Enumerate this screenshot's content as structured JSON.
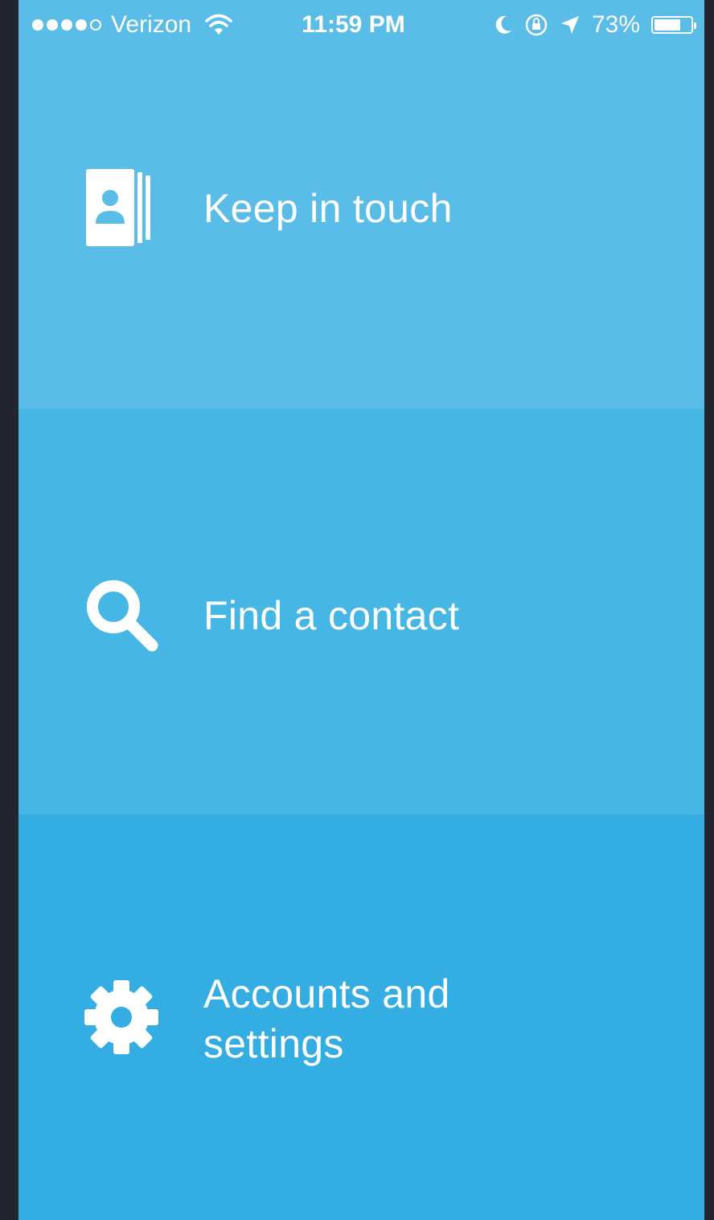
{
  "statusbar": {
    "carrier": "Verizon",
    "time": "11:59 PM",
    "battery": "73%",
    "battery_level": 0.73,
    "signal_bars_filled": 4,
    "signal_bars_total": 5
  },
  "menu": {
    "items": [
      {
        "label": "Keep in touch",
        "icon": "contacts-icon",
        "color": "#5abde7"
      },
      {
        "label": "Find a contact",
        "icon": "search-icon",
        "color": "#46b6e5"
      },
      {
        "label": "Accounts and\nsettings",
        "icon": "gear-icon",
        "color": "#33ade2"
      }
    ]
  },
  "colors": {
    "frame": "#23252e",
    "text": "#ffffff"
  }
}
